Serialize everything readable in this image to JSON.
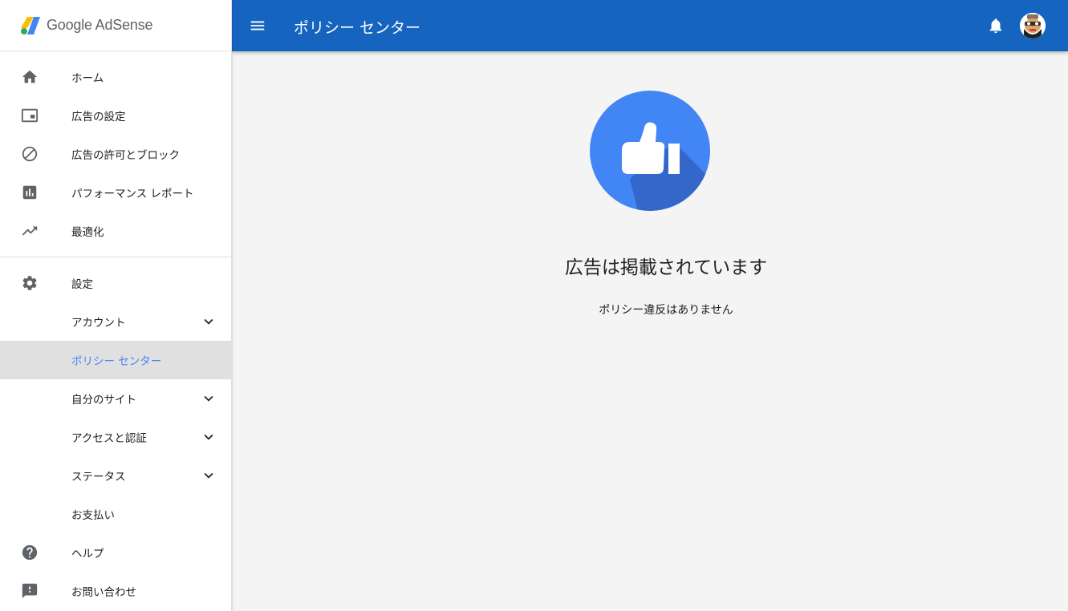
{
  "app": {
    "logo_text": "Google AdSense"
  },
  "sidebar": {
    "group1": [
      {
        "label": "ホーム",
        "icon": "home-icon"
      },
      {
        "label": "広告の設定",
        "icon": "ad-settings-icon"
      },
      {
        "label": "広告の許可とブロック",
        "icon": "block-icon"
      },
      {
        "label": "パフォーマンス レポート",
        "icon": "bar-chart-icon"
      },
      {
        "label": "最適化",
        "icon": "trending-up-icon"
      }
    ],
    "group2": [
      {
        "label": "設定",
        "icon": "gear-icon"
      },
      {
        "label": "アカウント",
        "expandable": true
      },
      {
        "label": "ポリシー センター",
        "active": true
      },
      {
        "label": "自分のサイト",
        "expandable": true
      },
      {
        "label": "アクセスと認証",
        "expandable": true
      },
      {
        "label": "ステータス",
        "expandable": true
      },
      {
        "label": "お支払い"
      },
      {
        "label": "ヘルプ",
        "icon": "help-icon"
      },
      {
        "label": "お問い合わせ",
        "icon": "feedback-icon"
      }
    ]
  },
  "header": {
    "title": "ポリシー センター"
  },
  "main": {
    "status_title": "広告は掲載されています",
    "status_subtitle": "ポリシー違反はありません"
  },
  "colors": {
    "topbar": "#1565c0",
    "accent": "#4285f4",
    "active_bg": "#e0e0e0"
  }
}
